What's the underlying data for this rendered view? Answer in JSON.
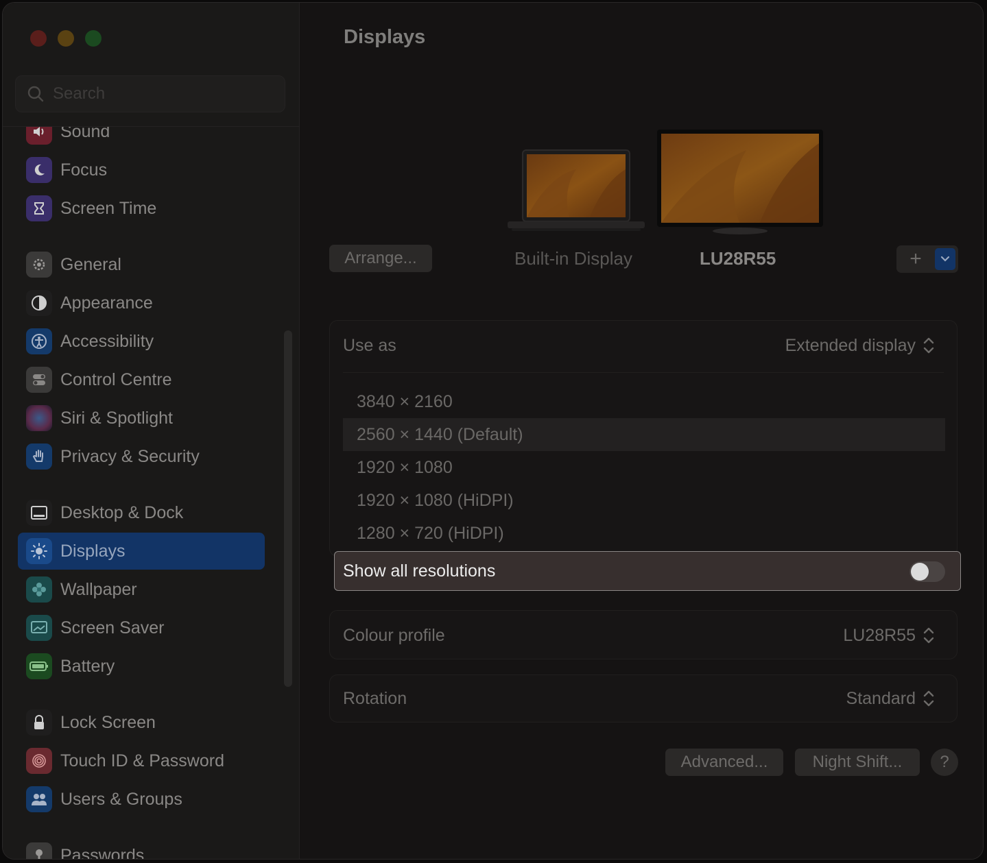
{
  "window": {
    "traffic_colors": [
      "#5a1e1b",
      "#5a4212",
      "#1b4a20"
    ]
  },
  "search": {
    "placeholder": "Search"
  },
  "sidebar": {
    "items": [
      {
        "label": "Sound",
        "icon": "speaker-icon",
        "color": "#6a1f2c"
      },
      {
        "label": "Focus",
        "icon": "moon-icon",
        "color": "#3a2e6a"
      },
      {
        "label": "Screen Time",
        "icon": "hourglass-icon",
        "color": "#3a2e6a"
      },
      {
        "label": "General",
        "icon": "gear-icon",
        "color": "#3b3a39"
      },
      {
        "label": "Appearance",
        "icon": "appearance-icon",
        "color": "#1f1e1e"
      },
      {
        "label": "Accessibility",
        "icon": "accessibility-icon",
        "color": "#143a6a"
      },
      {
        "label": "Control Centre",
        "icon": "toggles-icon",
        "color": "#3b3a39"
      },
      {
        "label": "Siri & Spotlight",
        "icon": "siri-icon",
        "color": "#2a1f3a"
      },
      {
        "label": "Privacy & Security",
        "icon": "hand-icon",
        "color": "#143a6a"
      },
      {
        "label": "Desktop & Dock",
        "icon": "dock-icon",
        "color": "#1f1e1e"
      },
      {
        "label": "Displays",
        "icon": "sun-icon",
        "color": "#143a6a"
      },
      {
        "label": "Wallpaper",
        "icon": "flower-icon",
        "color": "#1a4a4a"
      },
      {
        "label": "Screen Saver",
        "icon": "screensaver-icon",
        "color": "#1a4a4a"
      },
      {
        "label": "Battery",
        "icon": "battery-icon",
        "color": "#1b4a20"
      },
      {
        "label": "Lock Screen",
        "icon": "lock-icon",
        "color": "#1f1e1e"
      },
      {
        "label": "Touch ID & Password",
        "icon": "fingerprint-icon",
        "color": "#5a2226"
      },
      {
        "label": "Users & Groups",
        "icon": "users-icon",
        "color": "#143a6a"
      },
      {
        "label": "Passwords",
        "icon": "key-icon",
        "color": "#3b3a39"
      }
    ],
    "selected": "Displays"
  },
  "main": {
    "title": "Displays",
    "arrange_label": "Arrange...",
    "displays": [
      {
        "name": "Built-in Display"
      },
      {
        "name": "LU28R55"
      }
    ],
    "add_label": "+",
    "use_as": {
      "label": "Use as",
      "value": "Extended display"
    },
    "resolutions": [
      "3840 × 2160",
      "2560 × 1440 (Default)",
      "1920 × 1080",
      "1920 × 1080 (HiDPI)",
      "1280 × 720 (HiDPI)"
    ],
    "selected_resolution": "2560 × 1440 (Default)",
    "show_all": {
      "label": "Show all resolutions",
      "on": false
    },
    "colour_profile": {
      "label": "Colour profile",
      "value": "LU28R55"
    },
    "rotation": {
      "label": "Rotation",
      "value": "Standard"
    },
    "advanced_label": "Advanced...",
    "night_shift_label": "Night Shift...",
    "help_label": "?"
  }
}
